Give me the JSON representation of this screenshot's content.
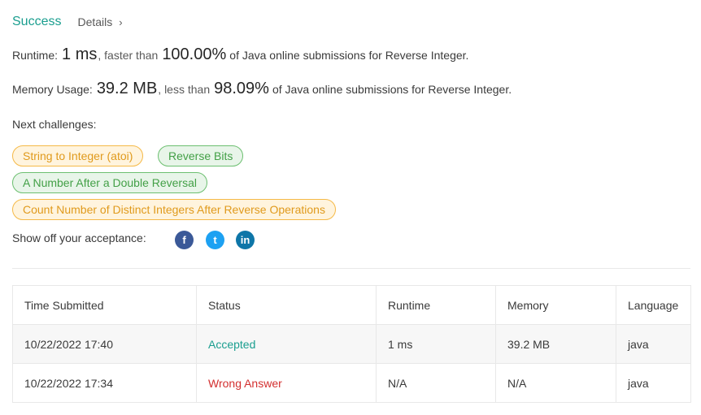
{
  "header": {
    "title": "Success",
    "details_label": "Details",
    "details_chevron": "›"
  },
  "runtime": {
    "label": "Runtime:",
    "value": "1 ms",
    "comparison": ", faster than",
    "percent": "100.00%",
    "suffix": "of Java online submissions for Reverse Integer."
  },
  "memory": {
    "label": "Memory Usage:",
    "value": "39.2 MB",
    "comparison": ", less than",
    "percent": "98.09%",
    "suffix": "of Java online submissions for Reverse Integer."
  },
  "next_challenges": {
    "label": "Next challenges:",
    "items": [
      {
        "label": "String to Integer (atoi)",
        "difficulty": "medium"
      },
      {
        "label": "Reverse Bits",
        "difficulty": "easy"
      },
      {
        "label": "A Number After a Double Reversal",
        "difficulty": "easy"
      },
      {
        "label": "Count Number of Distinct Integers After Reverse Operations",
        "difficulty": "medium"
      }
    ]
  },
  "share": {
    "label": "Show off your acceptance:",
    "icons": [
      "facebook-icon",
      "twitter-icon",
      "linkedin-icon"
    ],
    "glyphs": {
      "facebook": "f",
      "twitter": "t",
      "linkedin": "in"
    }
  },
  "colors": {
    "success": "#1a9e8f",
    "accepted": "#1a9e8f",
    "wrong_answer": "#d32f2f",
    "medium_border": "#f5b947",
    "easy_border": "#6cbf70",
    "facebook": "#3b5998",
    "twitter": "#1da1f2",
    "linkedin": "#0e76a8"
  },
  "table": {
    "headers": [
      "Time Submitted",
      "Status",
      "Runtime",
      "Memory",
      "Language"
    ],
    "rows": [
      {
        "time": "10/22/2022 17:40",
        "status": "Accepted",
        "runtime": "1 ms",
        "memory": "39.2 MB",
        "language": "java"
      },
      {
        "time": "10/22/2022 17:34",
        "status": "Wrong Answer",
        "runtime": "N/A",
        "memory": "N/A",
        "language": "java"
      }
    ]
  }
}
